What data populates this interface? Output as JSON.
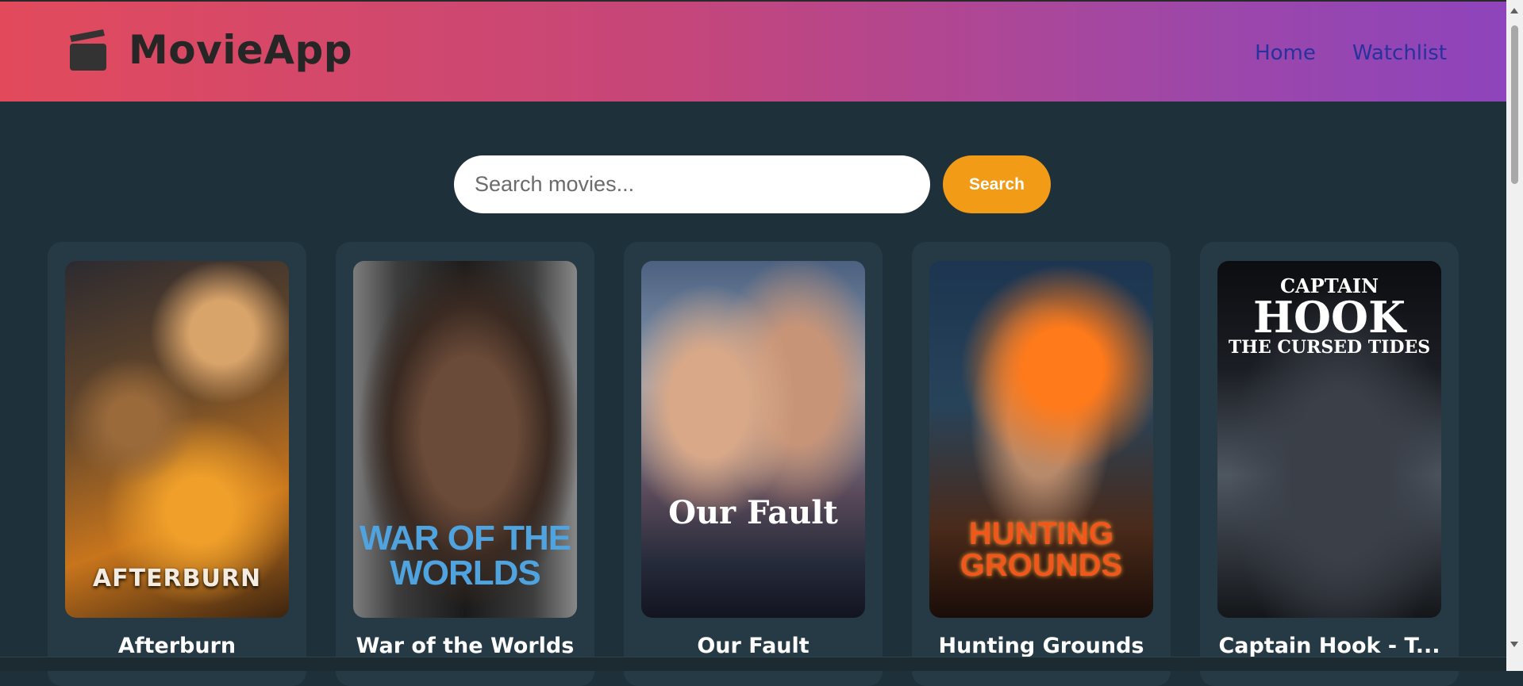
{
  "header": {
    "app_title": "MovieApp",
    "logo_icon": "clapperboard-icon",
    "nav": [
      {
        "label": "Home"
      },
      {
        "label": "Watchlist"
      }
    ]
  },
  "search": {
    "placeholder": "Search movies...",
    "value": "",
    "button_label": "Search"
  },
  "movies": [
    {
      "title": "Afterburn",
      "poster_text": "AFTERBURN"
    },
    {
      "title": "War of the Worlds",
      "poster_text": "WAR OF THE WORLDS"
    },
    {
      "title": "Our Fault",
      "poster_text": "Our Fault"
    },
    {
      "title": "Hunting Grounds",
      "poster_text": "HUNTING GROUNDS"
    },
    {
      "title": "Captain Hook - T...",
      "poster_text_lines": [
        "CAPTAIN",
        "HOOK",
        "THE CURSED TIDES"
      ]
    }
  ],
  "colors": {
    "header_gradient_start": "#e24a5c",
    "header_gradient_end": "#8e44bb",
    "page_background": "#1e3039",
    "card_background": "#253a44",
    "search_button": "#f29b16",
    "nav_link": "#26329e"
  }
}
